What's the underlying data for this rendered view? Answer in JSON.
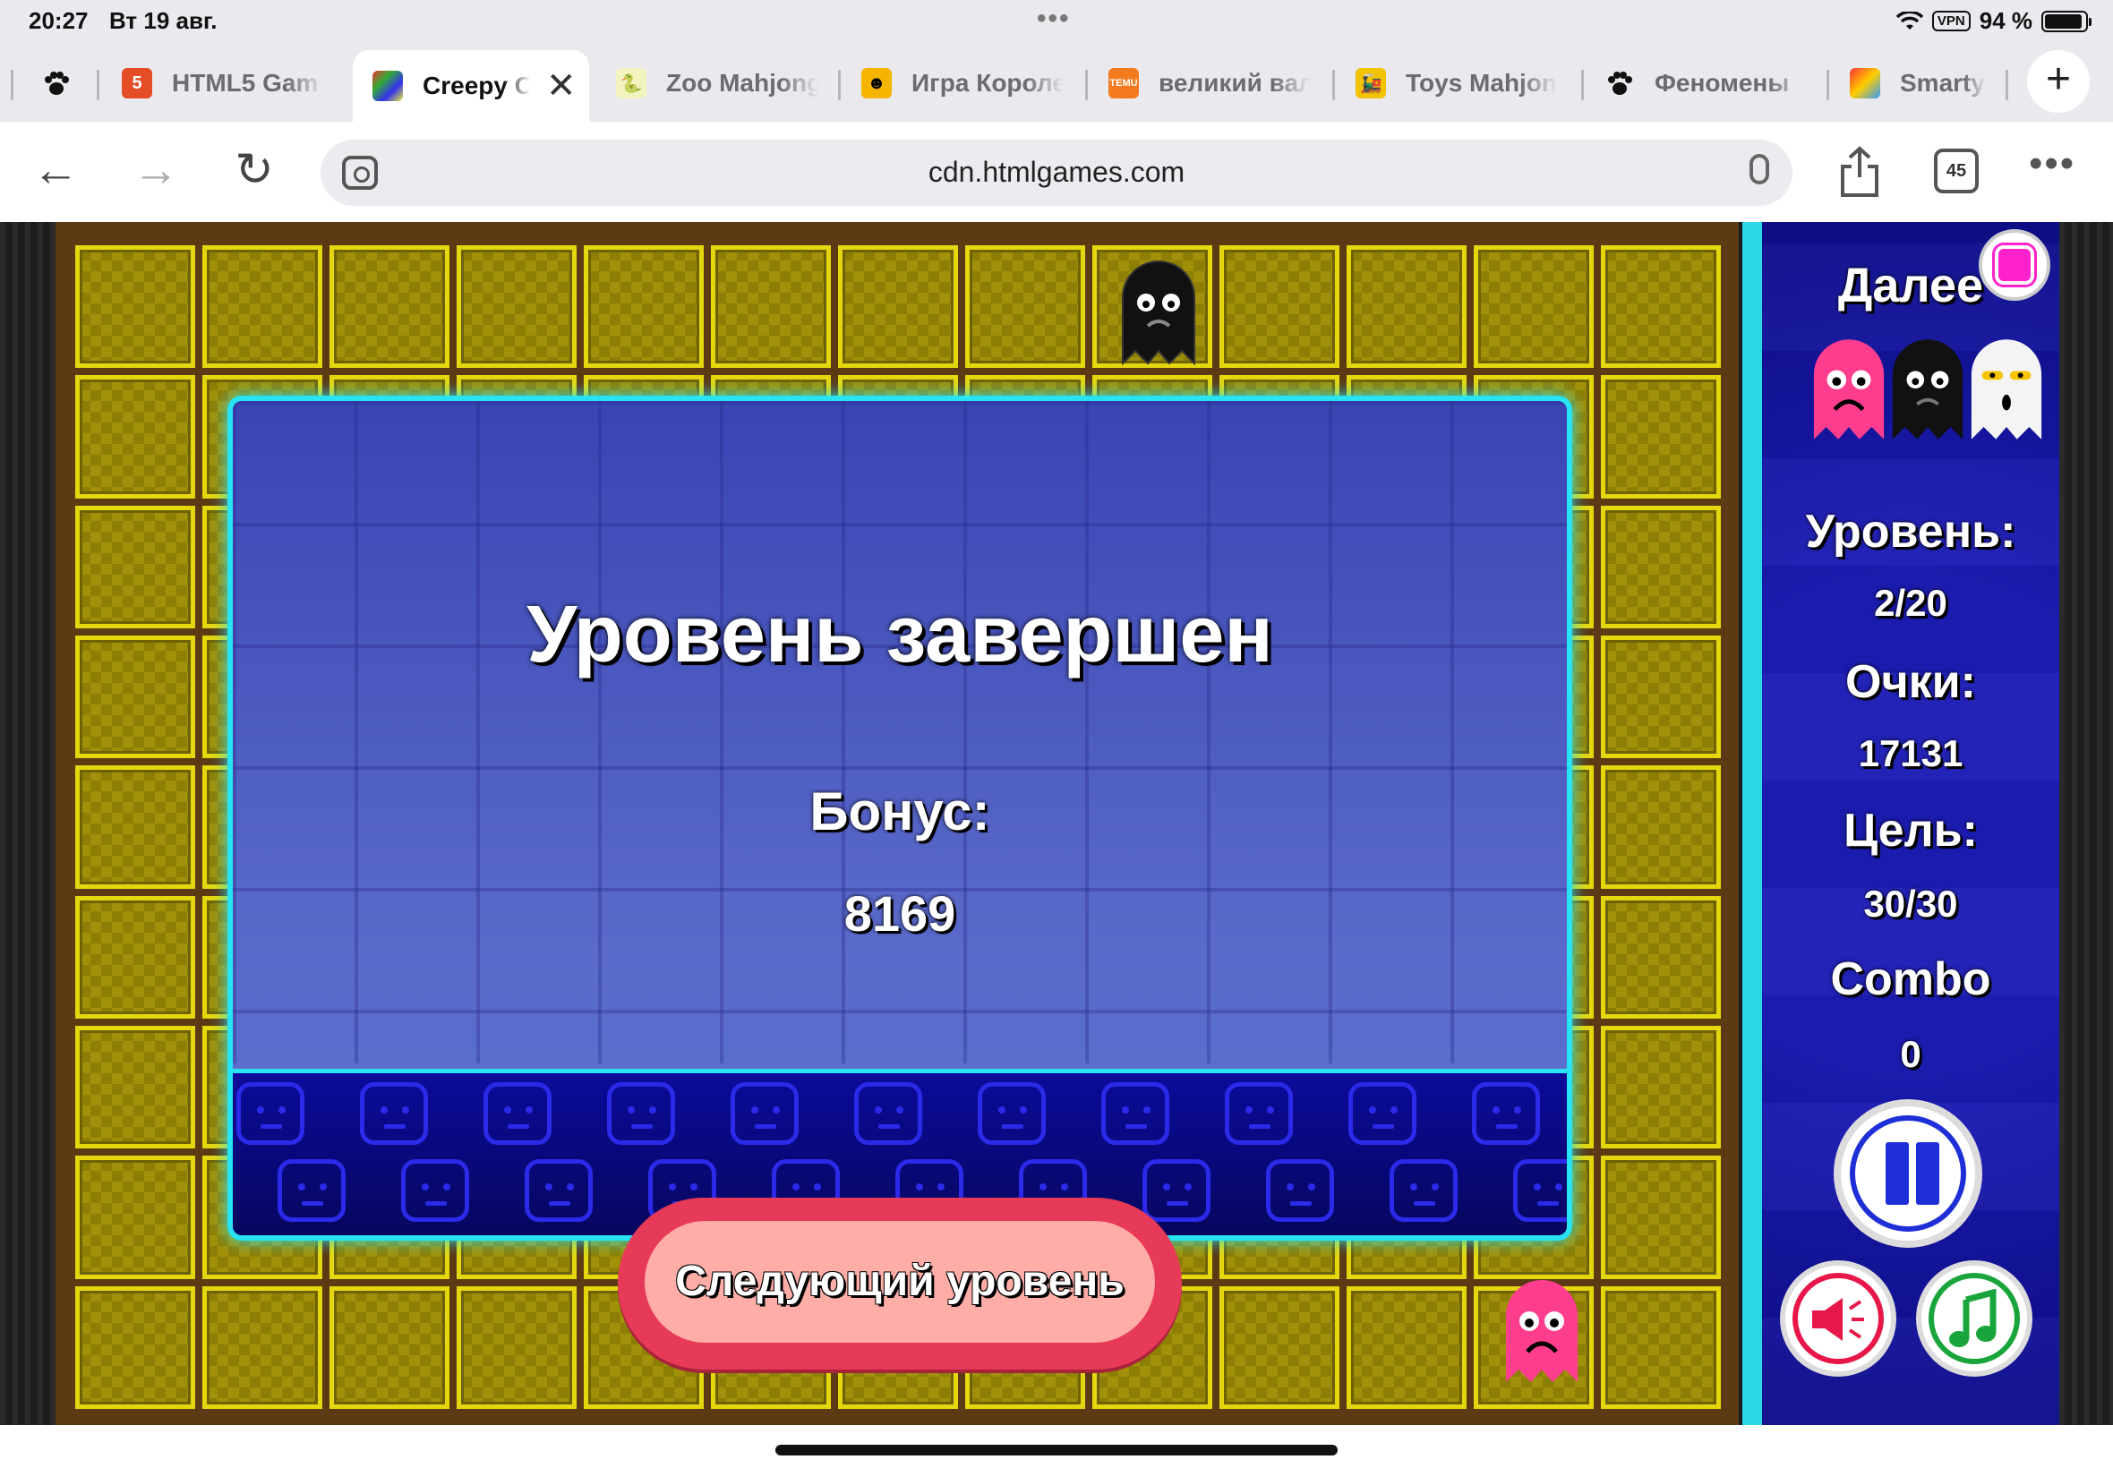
{
  "status_bar": {
    "time": "20:27",
    "date": "Вт 19 авг.",
    "vpn": "VPN",
    "battery": "94 %",
    "battery_level": 0.94
  },
  "tabs": [
    {
      "title": "",
      "icon": "paw-icon"
    },
    {
      "title": "HTML5 Gam",
      "icon": "html5-icon",
      "color": "#e44d26"
    },
    {
      "title": "Creepy C",
      "icon": "game-favicon",
      "active": true
    },
    {
      "title": "Zoo Mahjong",
      "icon": "zoo-favicon"
    },
    {
      "title": "Игра Короле",
      "icon": "frog-favicon"
    },
    {
      "title": "великий вал",
      "icon": "temu-favicon",
      "color": "#f47a20"
    },
    {
      "title": "Toys Mahjong",
      "icon": "toys-favicon"
    },
    {
      "title": "Феномены",
      "icon": "paw-icon"
    },
    {
      "title": "Smarty",
      "icon": "smarty-favicon"
    }
  ],
  "address_bar": {
    "url": "cdn.htmlgames.com",
    "tab_count": "45"
  },
  "game": {
    "next_label": "Далее",
    "level_label": "Уровень:",
    "level_value": "2/20",
    "score_label": "Очки:",
    "score_value": "17131",
    "goal_label": "Цель:",
    "goal_value": "30/30",
    "combo_label": "Combo",
    "combo_value": "0",
    "next_ghosts": [
      "pink-sad-ghost-icon",
      "black-ghost-icon",
      "white-ghost-icon"
    ],
    "colors": {
      "board": "#a19009",
      "accent": "#28e3f2",
      "panel": "#0d0d8a"
    }
  },
  "dialog": {
    "title": "Уровень завершен",
    "bonus_label": "Бонус:",
    "bonus_value": "8169",
    "next_level_button": "Следующий уровень"
  }
}
